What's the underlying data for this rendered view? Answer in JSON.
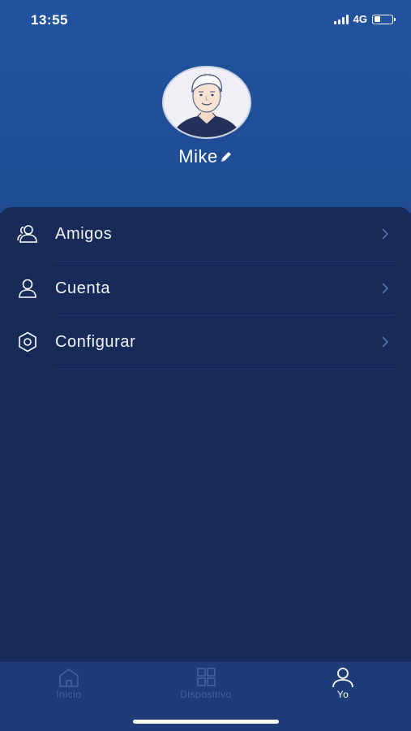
{
  "status_bar": {
    "time": "13:55",
    "network": "4G",
    "battery_level": 0.35
  },
  "profile": {
    "name": "Mike",
    "avatar_icon": "user-avatar-icon",
    "edit_icon": "pencil-icon"
  },
  "menu": {
    "items": [
      {
        "label": "Amigos",
        "icon": "friends-icon"
      },
      {
        "label": "Cuenta",
        "icon": "user-icon"
      },
      {
        "label": "Configurar",
        "icon": "hexagon-settings-icon"
      }
    ]
  },
  "tabbar": {
    "tabs": [
      {
        "label": "Inicio",
        "icon": "home-icon",
        "active": false
      },
      {
        "label": "Dispositivo",
        "icon": "grid-icon",
        "active": false
      },
      {
        "label": "Yo",
        "icon": "user-icon",
        "active": true
      }
    ]
  },
  "colors": {
    "header": "#21539f",
    "panel": "#172a58",
    "tabbar": "#1e3d78",
    "inactive_tab": "#46629f"
  }
}
